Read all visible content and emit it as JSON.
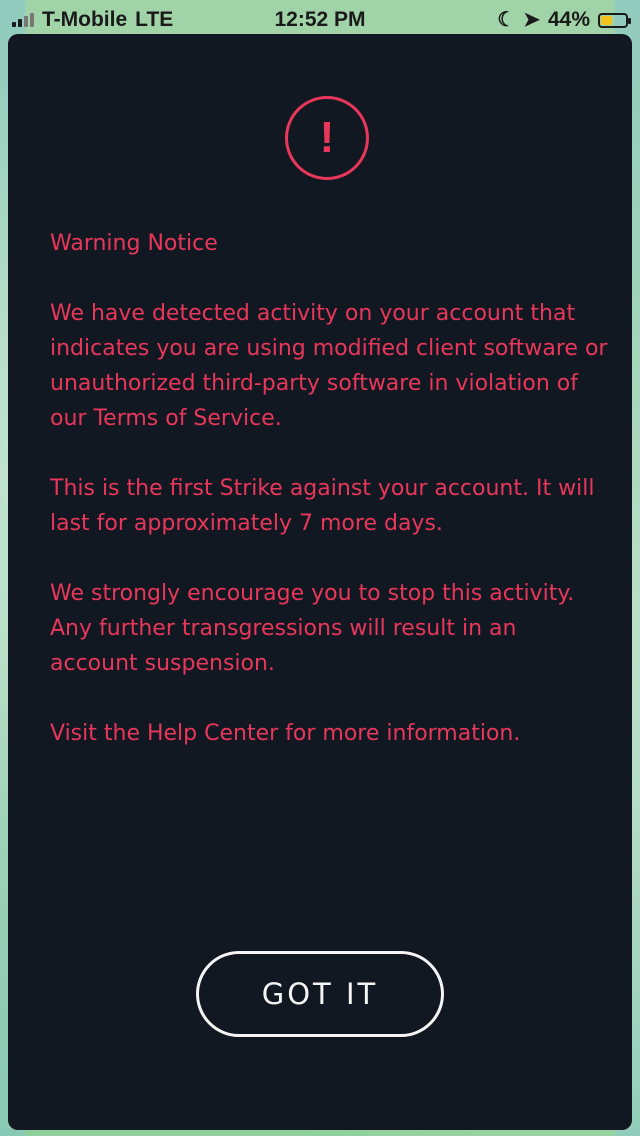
{
  "status_bar": {
    "carrier": "T-Mobile",
    "network": "LTE",
    "time": "12:52 PM",
    "battery_percent": "44%",
    "battery_level": 0.44,
    "moon_icon": "moon-icon",
    "location_icon": "location-arrow-icon"
  },
  "dialog": {
    "icon": "exclamation-circle-icon",
    "icon_glyph": "!",
    "title": "Warning Notice",
    "paragraph_1_before": "We have detected activity on your account that indicates you are using modified client software or unauthorized third-party software in violation of our ",
    "tos_link": "Terms of Service",
    "paragraph_1_after": ".",
    "paragraph_2": "This is the first Strike against your account. It will last for approximately 7 more days.",
    "paragraph_3": "We strongly encourage you to stop this activity. Any further transgressions will result in an account suspension.",
    "help_link": "Visit the Help Center",
    "paragraph_4_after": " for more information.",
    "button_label": "GOT IT"
  },
  "colors": {
    "accent": "#e8375a",
    "panel_background": "#121821",
    "button_text": "#f5f5f5"
  }
}
